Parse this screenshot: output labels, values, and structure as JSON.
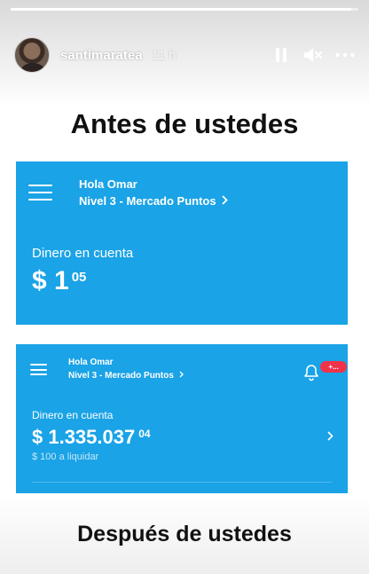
{
  "story": {
    "progress": 0.98,
    "username": "santimaratea",
    "timestamp": "11 h",
    "controls": {
      "pause_icon": "pause-icon",
      "mute_icon": "muted-speaker-icon",
      "more_icon": "more-options-icon"
    }
  },
  "headline_top": "Antes de ustedes",
  "headline_bottom": "Después de ustedes",
  "card_before": {
    "greeting": "Hola Omar",
    "level": "Nivel 3 - Mercado Puntos",
    "balance_label": "Dinero en cuenta",
    "balance_main": "$ 1",
    "balance_cents": "05"
  },
  "card_after": {
    "greeting": "Hola Omar",
    "level": "Nivel 3 - Mercado Puntos",
    "notification_badge": "+...",
    "balance_label": "Dinero en cuenta",
    "balance_main": "$ 1.335.037",
    "balance_cents": "04",
    "pending": "$ 100 a liquidar"
  },
  "colors": {
    "card_blue": "#1aa3e6",
    "badge_red": "#f0334a",
    "text_dark": "#111111"
  }
}
